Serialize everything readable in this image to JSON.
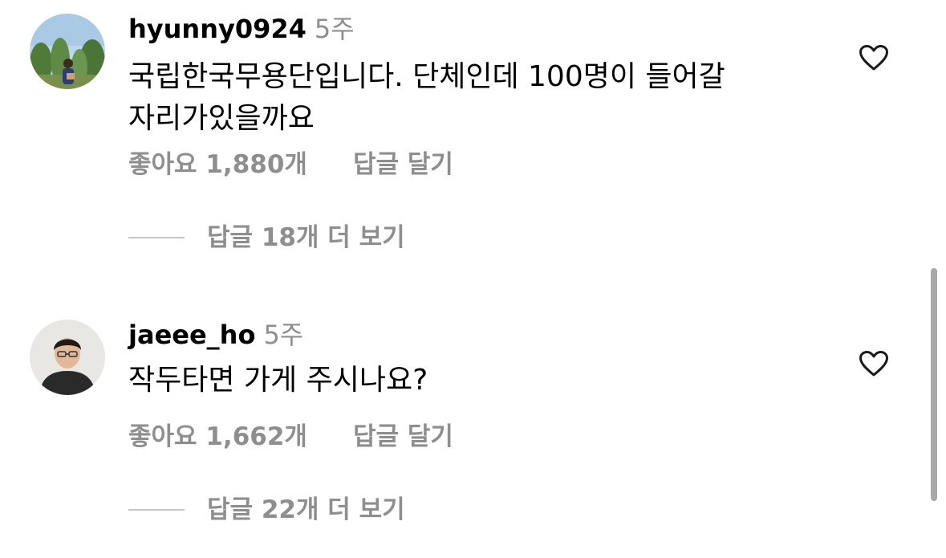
{
  "comments": [
    {
      "username": "hyunny0924",
      "time": "5주",
      "text_line1": "국립한국무용단입니다. 단체인데 100명이 들어갈",
      "text_line2": "자리가있을까요",
      "likes": "좋아요 1,880개",
      "reply_label": "답글 달기",
      "view_replies": "답글 18개 더 보기",
      "avatar_icon": "profile-photo-outdoor-trees"
    },
    {
      "username": "jaeee_ho",
      "time": "5주",
      "text_line1": "작두타면 가게 주시나요?",
      "likes": "좋아요 1,662개",
      "reply_label": "답글 달기",
      "view_replies": "답글 22개 더 보기",
      "avatar_icon": "profile-photo-man-portrait"
    }
  ],
  "icons": {
    "like": "heart-outline-icon"
  },
  "colors": {
    "text": "#000000",
    "secondary_text": "#8e8e8e",
    "divider": "#c7c7c7",
    "scrollbar": "#a8a8a8"
  }
}
